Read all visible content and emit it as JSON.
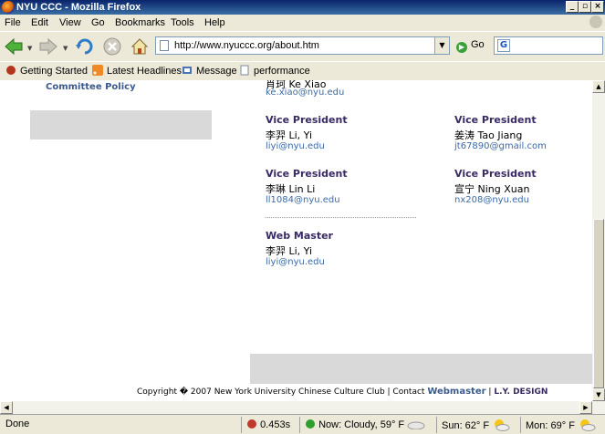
{
  "window": {
    "title": "NYU CCC - Mozilla Firefox"
  },
  "menu": [
    "File",
    "Edit",
    "View",
    "Go",
    "Bookmarks",
    "Tools",
    "Help"
  ],
  "nav": {
    "url": "http://www.nyuccc.org/about.htm",
    "go_label": "Go",
    "search_placeholder": ""
  },
  "bookmarks": [
    "Getting Started",
    "Latest Headlines",
    "Message",
    "performance"
  ],
  "page": {
    "sidebar_link": "Committee Policy",
    "cut_name": "肖珂 Ke Xiao",
    "cut_email": "ke.xiao@nyu.edu",
    "officers": [
      {
        "role": "Vice President",
        "name": "李羿 Li, Yi",
        "email": "liyi@nyu.edu"
      },
      {
        "role": "Vice President",
        "name": "姜涛 Tao Jiang",
        "email": "jt67890@gmail.com"
      },
      {
        "role": "Vice President",
        "name": "李琳 Lin Li",
        "email": "ll1084@nyu.edu"
      },
      {
        "role": "Vice President",
        "name": "宣宁 Ning Xuan",
        "email": "nx208@nyu.edu"
      },
      {
        "role": "Web Master",
        "name": "李羿 Li, Yi",
        "email": "liyi@nyu.edu"
      }
    ],
    "footer": {
      "copyright": "Copyright � 2007 New York University Chinese Culture Club | Contact",
      "webmaster": "Webmaster",
      "separator": "|",
      "design": "L.Y. DESIGN"
    }
  },
  "status": {
    "text": "Done",
    "timing": "0.453s",
    "weather_now": "Now: Cloudy, 59° F",
    "weather_sun": "Sun: 62° F",
    "weather_mon": "Mon: 69° F"
  }
}
